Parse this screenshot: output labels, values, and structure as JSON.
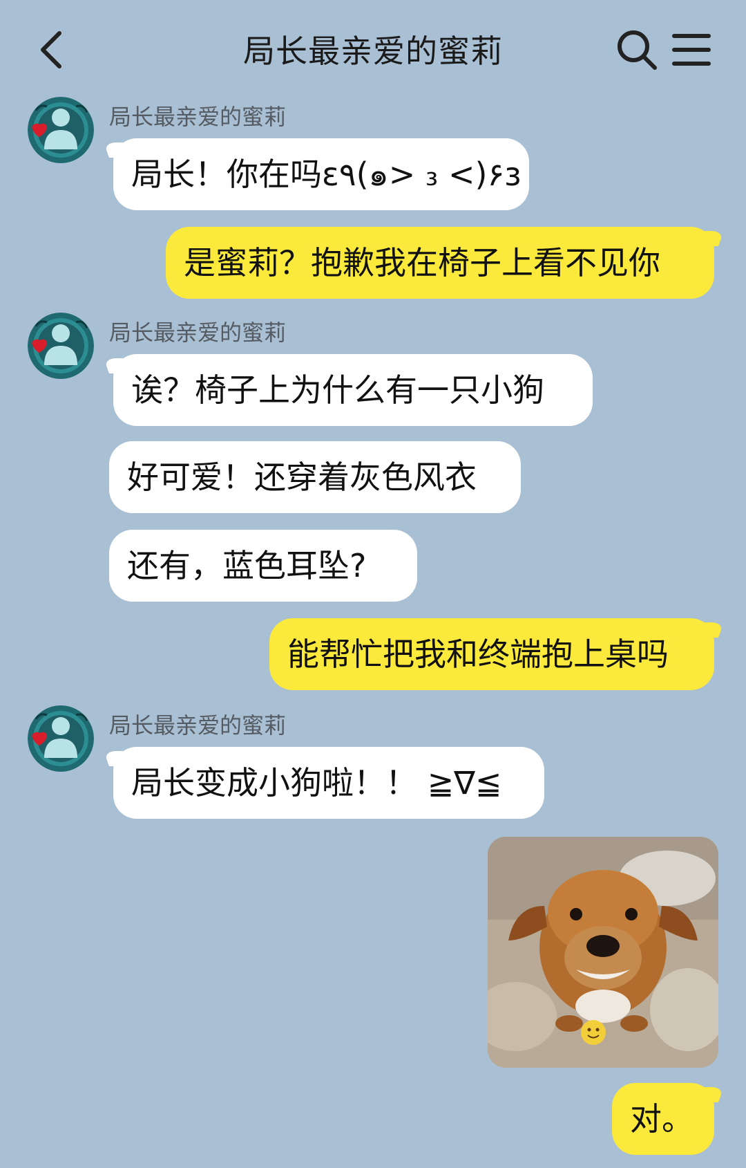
{
  "header": {
    "title": "局长最亲爱的蜜莉"
  },
  "messages": [
    {
      "side": "in",
      "sender": "局长最亲爱的蜜莉",
      "text": "局长！你在吗ε٩(๑> ₃ <)۶з"
    },
    {
      "side": "out",
      "text": "是蜜莉？抱歉我在椅子上看不见你"
    },
    {
      "side": "in",
      "sender": "局长最亲爱的蜜莉",
      "text": "诶？椅子上为什么有一只小狗"
    },
    {
      "side": "in",
      "text": "好可爱！还穿着灰色风衣"
    },
    {
      "side": "in",
      "text": "还有，蓝色耳坠?"
    },
    {
      "side": "out",
      "text": "能帮忙把我和终端抱上桌吗"
    },
    {
      "side": "in",
      "sender": "局长最亲爱的蜜莉",
      "text": "局长变成小狗啦！！ ≧∇≦"
    },
    {
      "side": "out",
      "type": "image",
      "description_icon": "puppy-photo"
    },
    {
      "side": "out",
      "text": "对。"
    }
  ],
  "colors": {
    "background": "#a9bfd3",
    "incoming_bubble": "#ffffff",
    "outgoing_bubble": "#fbea3c"
  },
  "icons": {
    "back": "chevron-left-icon",
    "search": "search-icon",
    "menu": "menu-icon"
  }
}
